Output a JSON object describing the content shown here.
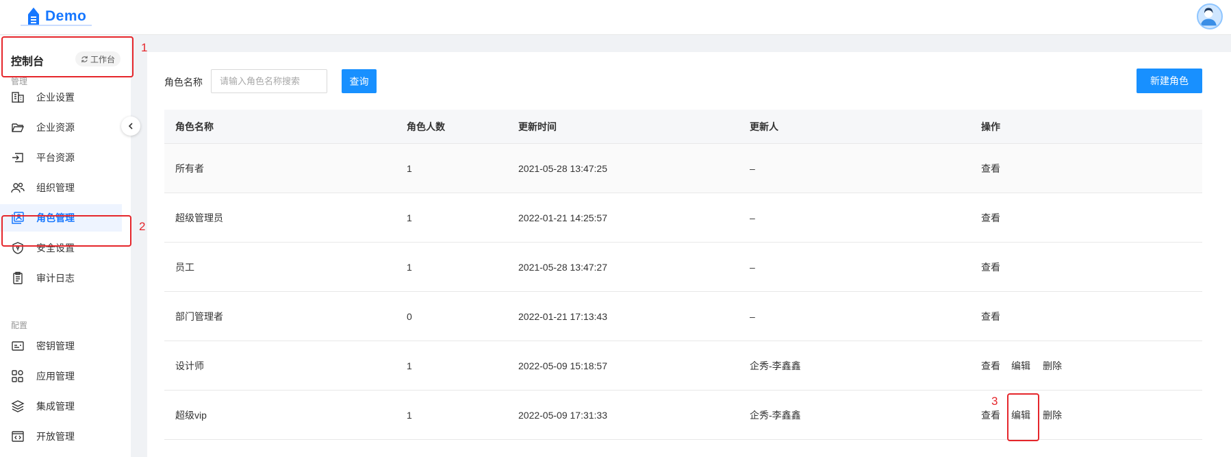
{
  "header": {
    "logo_text": "Demo"
  },
  "sidebar": {
    "title": "控制台",
    "workbench_label": "工作台",
    "sections": [
      {
        "label": "管理",
        "items": [
          {
            "label": "企业设置",
            "icon": "building-icon"
          },
          {
            "label": "企业资源",
            "icon": "folder-open-icon"
          },
          {
            "label": "平台资源",
            "icon": "login-icon"
          },
          {
            "label": "组织管理",
            "icon": "users-icon"
          },
          {
            "label": "角色管理",
            "icon": "role-card-icon",
            "active": true
          },
          {
            "label": "安全设置",
            "icon": "shield-icon"
          },
          {
            "label": "审计日志",
            "icon": "clipboard-icon"
          }
        ]
      },
      {
        "label": "配置",
        "items": [
          {
            "label": "密钥管理",
            "icon": "key-card-icon"
          },
          {
            "label": "应用管理",
            "icon": "apps-grid-icon"
          },
          {
            "label": "集成管理",
            "icon": "layers-icon"
          },
          {
            "label": "开放管理",
            "icon": "code-window-icon"
          }
        ]
      }
    ]
  },
  "filter": {
    "label": "角色名称",
    "placeholder": "请输入角色名称搜索",
    "query_button": "查询",
    "new_button": "新建角色"
  },
  "table": {
    "headers": [
      "角色名称",
      "角色人数",
      "更新时间",
      "更新人",
      "操作"
    ],
    "rows": [
      {
        "name": "所有者",
        "count": "1",
        "time": "2021-05-28 13:47:25",
        "updater": "–",
        "actions": [
          "查看"
        ]
      },
      {
        "name": "超级管理员",
        "count": "1",
        "time": "2022-01-21 14:25:57",
        "updater": "–",
        "actions": [
          "查看"
        ]
      },
      {
        "name": "员工",
        "count": "1",
        "time": "2021-05-28 13:47:27",
        "updater": "–",
        "actions": [
          "查看"
        ]
      },
      {
        "name": "部门管理者",
        "count": "0",
        "time": "2022-01-21 17:13:43",
        "updater": "–",
        "actions": [
          "查看"
        ]
      },
      {
        "name": "设计师",
        "count": "1",
        "time": "2022-05-09 15:18:57",
        "updater": "企秀-李鑫鑫",
        "actions": [
          "查看",
          "编辑",
          "删除"
        ]
      },
      {
        "name": "超级vip",
        "count": "1",
        "time": "2022-05-09 17:31:33",
        "updater": "企秀-李鑫鑫",
        "actions": [
          "查看",
          "编辑",
          "删除"
        ]
      }
    ]
  },
  "annotations": [
    "1",
    "2",
    "3"
  ],
  "colors": {
    "primary": "#1890ff",
    "annotation": "#e5252a",
    "active_bg": "#eef4ff"
  }
}
